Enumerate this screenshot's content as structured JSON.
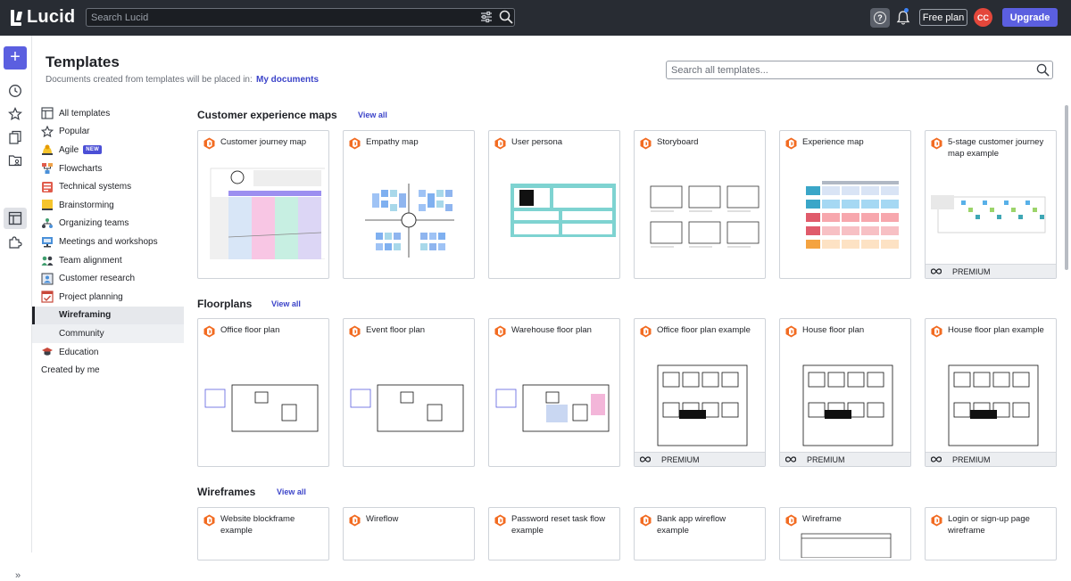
{
  "topbar": {
    "brand": "Lucid",
    "search_placeholder": "Search Lucid",
    "free_plan": "Free plan",
    "avatar_initials": "CC",
    "upgrade": "Upgrade"
  },
  "header": {
    "title": "Templates",
    "subtitle": "Documents created from templates will be placed in:",
    "destination": "My documents",
    "search_placeholder": "Search all templates..."
  },
  "nav": {
    "items": [
      {
        "label": "All templates",
        "icon": "all-templates-icon"
      },
      {
        "label": "Popular",
        "icon": "star-icon"
      },
      {
        "label": "Agile",
        "icon": "agile-icon",
        "badge": "NEW"
      },
      {
        "label": "Flowcharts",
        "icon": "flowchart-icon"
      },
      {
        "label": "Technical systems",
        "icon": "technical-systems-icon"
      },
      {
        "label": "Brainstorming",
        "icon": "brainstorming-icon"
      },
      {
        "label": "Organizing teams",
        "icon": "org-chart-icon"
      },
      {
        "label": "Meetings and workshops",
        "icon": "meetings-icon"
      },
      {
        "label": "Team alignment",
        "icon": "team-alignment-icon"
      },
      {
        "label": "Customer research",
        "icon": "customer-research-icon"
      },
      {
        "label": "Project planning",
        "icon": "project-planning-icon"
      },
      {
        "label": "Wireframing",
        "icon": "wireframing-icon"
      },
      {
        "label": "Community",
        "icon": "community-icon"
      },
      {
        "label": "Education",
        "icon": "education-icon"
      },
      {
        "label": "Created by me",
        "icon": ""
      }
    ],
    "active": "Wireframing"
  },
  "sections": [
    {
      "title": "Customer experience maps",
      "view_all": "View all",
      "cards": [
        {
          "name": "Customer journey map",
          "premium": false
        },
        {
          "name": "Empathy map",
          "premium": false
        },
        {
          "name": "User persona",
          "premium": false
        },
        {
          "name": "Storyboard",
          "premium": false
        },
        {
          "name": "Experience map",
          "premium": false
        },
        {
          "name": "5-stage customer journey map example",
          "premium": true
        }
      ]
    },
    {
      "title": "Floorplans",
      "view_all": "View all",
      "cards": [
        {
          "name": "Office floor plan",
          "premium": false
        },
        {
          "name": "Event floor plan",
          "premium": false
        },
        {
          "name": "Warehouse floor plan",
          "premium": false
        },
        {
          "name": "Office floor plan example",
          "premium": true
        },
        {
          "name": "House floor plan",
          "premium": true
        },
        {
          "name": "House floor plan example",
          "premium": true
        }
      ]
    },
    {
      "title": "Wireframes",
      "view_all": "View all",
      "cards": [
        {
          "name": "Website blockframe example",
          "premium": false
        },
        {
          "name": "Wireflow",
          "premium": false
        },
        {
          "name": "Password reset task flow example",
          "premium": false
        },
        {
          "name": "Bank app wireflow example",
          "premium": false
        },
        {
          "name": "Wireframe",
          "premium": false
        },
        {
          "name": "Login or sign-up page wireframe",
          "premium": false
        }
      ]
    }
  ],
  "premium_label": "PREMIUM",
  "colors": {
    "topbar": "#282c33",
    "accent": "#5b5fe0",
    "link": "#3c44c9",
    "logo_orange": "#f26b21",
    "avatar": "#e4473b"
  }
}
